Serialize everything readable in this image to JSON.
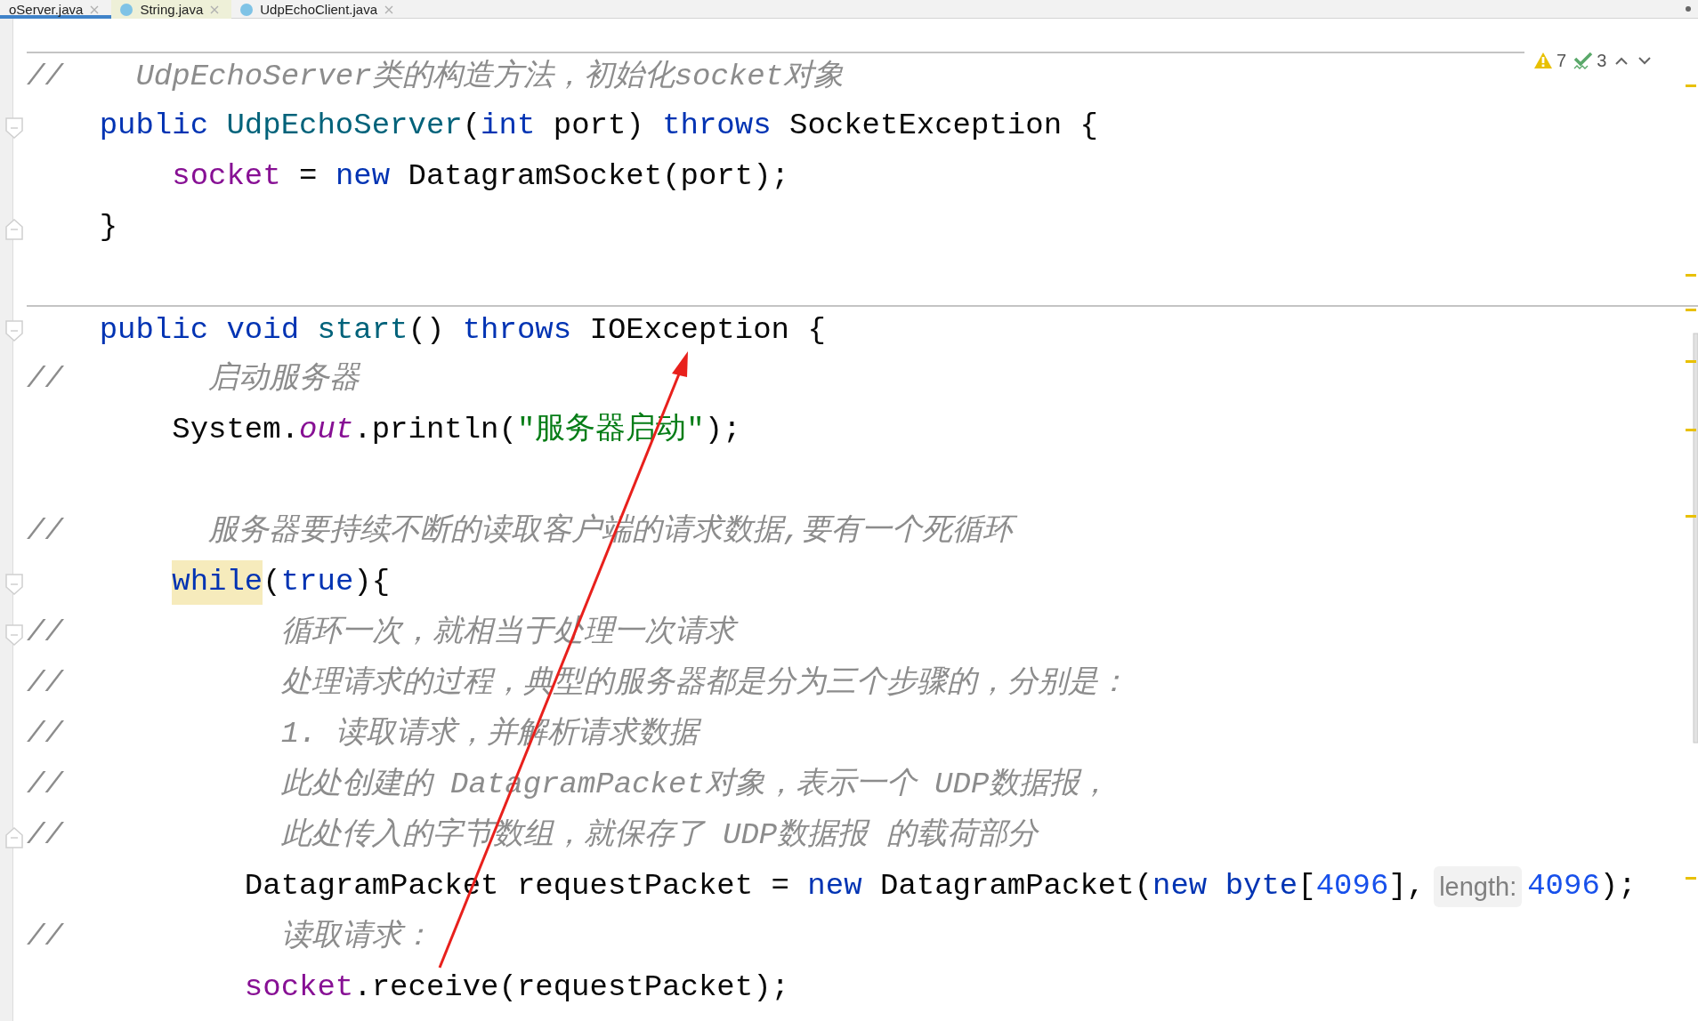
{
  "tabs": [
    {
      "label": "oServer.java",
      "selected": true,
      "non_project": false
    },
    {
      "label": "String.java",
      "selected": false,
      "non_project": true
    },
    {
      "label": "UdpEchoClient.java",
      "selected": false,
      "non_project": false
    }
  ],
  "inspections": {
    "warnings": "7",
    "weak_warnings": "3"
  },
  "lines": [
    {
      "fold_start": false,
      "fold_end": false,
      "separator": true,
      "tokens": [
        {
          "kind": "comment",
          "text": "//    UdpEchoServer类的构造方法，初始化socket对象"
        }
      ]
    },
    {
      "fold_start": true,
      "fold_end": false,
      "separator": false,
      "tokens": [
        {
          "kind": "keyword",
          "text": "    public"
        },
        {
          "kind": "method",
          "text": " UdpEchoServer"
        },
        {
          "kind": "plain",
          "text": "("
        },
        {
          "kind": "keyword",
          "text": "int"
        },
        {
          "kind": "plain",
          "text": " port) "
        },
        {
          "kind": "keyword",
          "text": "throws"
        },
        {
          "kind": "plain",
          "text": " SocketException {"
        }
      ]
    },
    {
      "fold_start": false,
      "fold_end": false,
      "separator": false,
      "tokens": [
        {
          "kind": "field",
          "text": "        socket"
        },
        {
          "kind": "plain",
          "text": " = "
        },
        {
          "kind": "keyword",
          "text": "new"
        },
        {
          "kind": "plain",
          "text": " DatagramSocket(port);"
        }
      ]
    },
    {
      "fold_start": false,
      "fold_end": true,
      "separator": false,
      "tokens": [
        {
          "kind": "plain",
          "text": "    }"
        }
      ]
    },
    {
      "fold_start": false,
      "fold_end": false,
      "separator": false
    },
    {
      "fold_start": true,
      "fold_end": false,
      "separator": true,
      "tokens": [
        {
          "kind": "keyword",
          "text": "    public void"
        },
        {
          "kind": "method",
          "text": " start"
        },
        {
          "kind": "plain",
          "text": "() "
        },
        {
          "kind": "keyword",
          "text": "throws"
        },
        {
          "kind": "plain",
          "text": " IOException {"
        }
      ]
    },
    {
      "fold_start": false,
      "fold_end": false,
      "separator": false,
      "tokens": [
        {
          "kind": "comment",
          "text": "//        启动服务器"
        }
      ]
    },
    {
      "fold_start": false,
      "fold_end": false,
      "separator": false,
      "tokens": [
        {
          "kind": "plain",
          "text": "        System."
        },
        {
          "kind": "static",
          "text": "out"
        },
        {
          "kind": "plain",
          "text": ".println("
        },
        {
          "kind": "string",
          "text": "\"服务器启动\""
        },
        {
          "kind": "plain",
          "text": ");"
        }
      ]
    },
    {
      "fold_start": false,
      "fold_end": false,
      "separator": false
    },
    {
      "fold_start": false,
      "fold_end": false,
      "separator": false,
      "tokens": [
        {
          "kind": "comment",
          "text": "//        服务器要持续不断的读取客户端的请求数据,要有一个死循环"
        }
      ]
    },
    {
      "fold_start": true,
      "fold_end": false,
      "separator": false,
      "tokens": [
        {
          "kind": "highlighted_keyword",
          "text": "        while"
        },
        {
          "kind": "plain",
          "text": "("
        },
        {
          "kind": "keyword",
          "text": "true"
        },
        {
          "kind": "plain",
          "text": "){"
        }
      ]
    },
    {
      "fold_start": true,
      "fold_end": false,
      "separator": false,
      "tokens": [
        {
          "kind": "comment",
          "text": "//            循环一次，就相当于处理一次请求"
        }
      ]
    },
    {
      "fold_start": false,
      "fold_end": false,
      "separator": false,
      "tokens": [
        {
          "kind": "comment",
          "text": "//            处理请求的过程，典型的服务器都是分为三个步骤的，分别是："
        }
      ]
    },
    {
      "fold_start": false,
      "fold_end": false,
      "separator": false,
      "tokens": [
        {
          "kind": "comment",
          "text": "//            1. 读取请求，并解析请求数据"
        }
      ]
    },
    {
      "fold_start": false,
      "fold_end": false,
      "separator": false,
      "tokens": [
        {
          "kind": "comment",
          "text": "//            此处创建的 DatagramPacket对象，表示一个 UDP数据报，"
        }
      ]
    },
    {
      "fold_start": false,
      "fold_end": true,
      "separator": false,
      "tokens": [
        {
          "kind": "comment",
          "text": "//            此处传入的字节数组，就保存了 UDP数据报 的载荷部分"
        }
      ]
    },
    {
      "fold_start": false,
      "fold_end": false,
      "separator": false,
      "tokens": [
        {
          "kind": "plain",
          "text": "            DatagramPacket requestPacket = "
        },
        {
          "kind": "keyword",
          "text": "new"
        },
        {
          "kind": "plain",
          "text": " DatagramPacket("
        },
        {
          "kind": "keyword",
          "text": "new byte"
        },
        {
          "kind": "plain",
          "text": "["
        },
        {
          "kind": "number",
          "text": "4096"
        },
        {
          "kind": "plain",
          "text": "],"
        },
        {
          "kind": "hint",
          "text": "length:"
        },
        {
          "kind": "number",
          "text": "4096"
        },
        {
          "kind": "plain",
          "text": ");"
        }
      ]
    },
    {
      "fold_start": false,
      "fold_end": false,
      "separator": false,
      "tokens": [
        {
          "kind": "comment",
          "text": "//            读取请求："
        }
      ]
    },
    {
      "fold_start": false,
      "fold_end": false,
      "separator": false,
      "tokens": [
        {
          "kind": "field",
          "text": "            socket"
        },
        {
          "kind": "plain",
          "text": ".receive(requestPacket);"
        }
      ]
    }
  ]
}
